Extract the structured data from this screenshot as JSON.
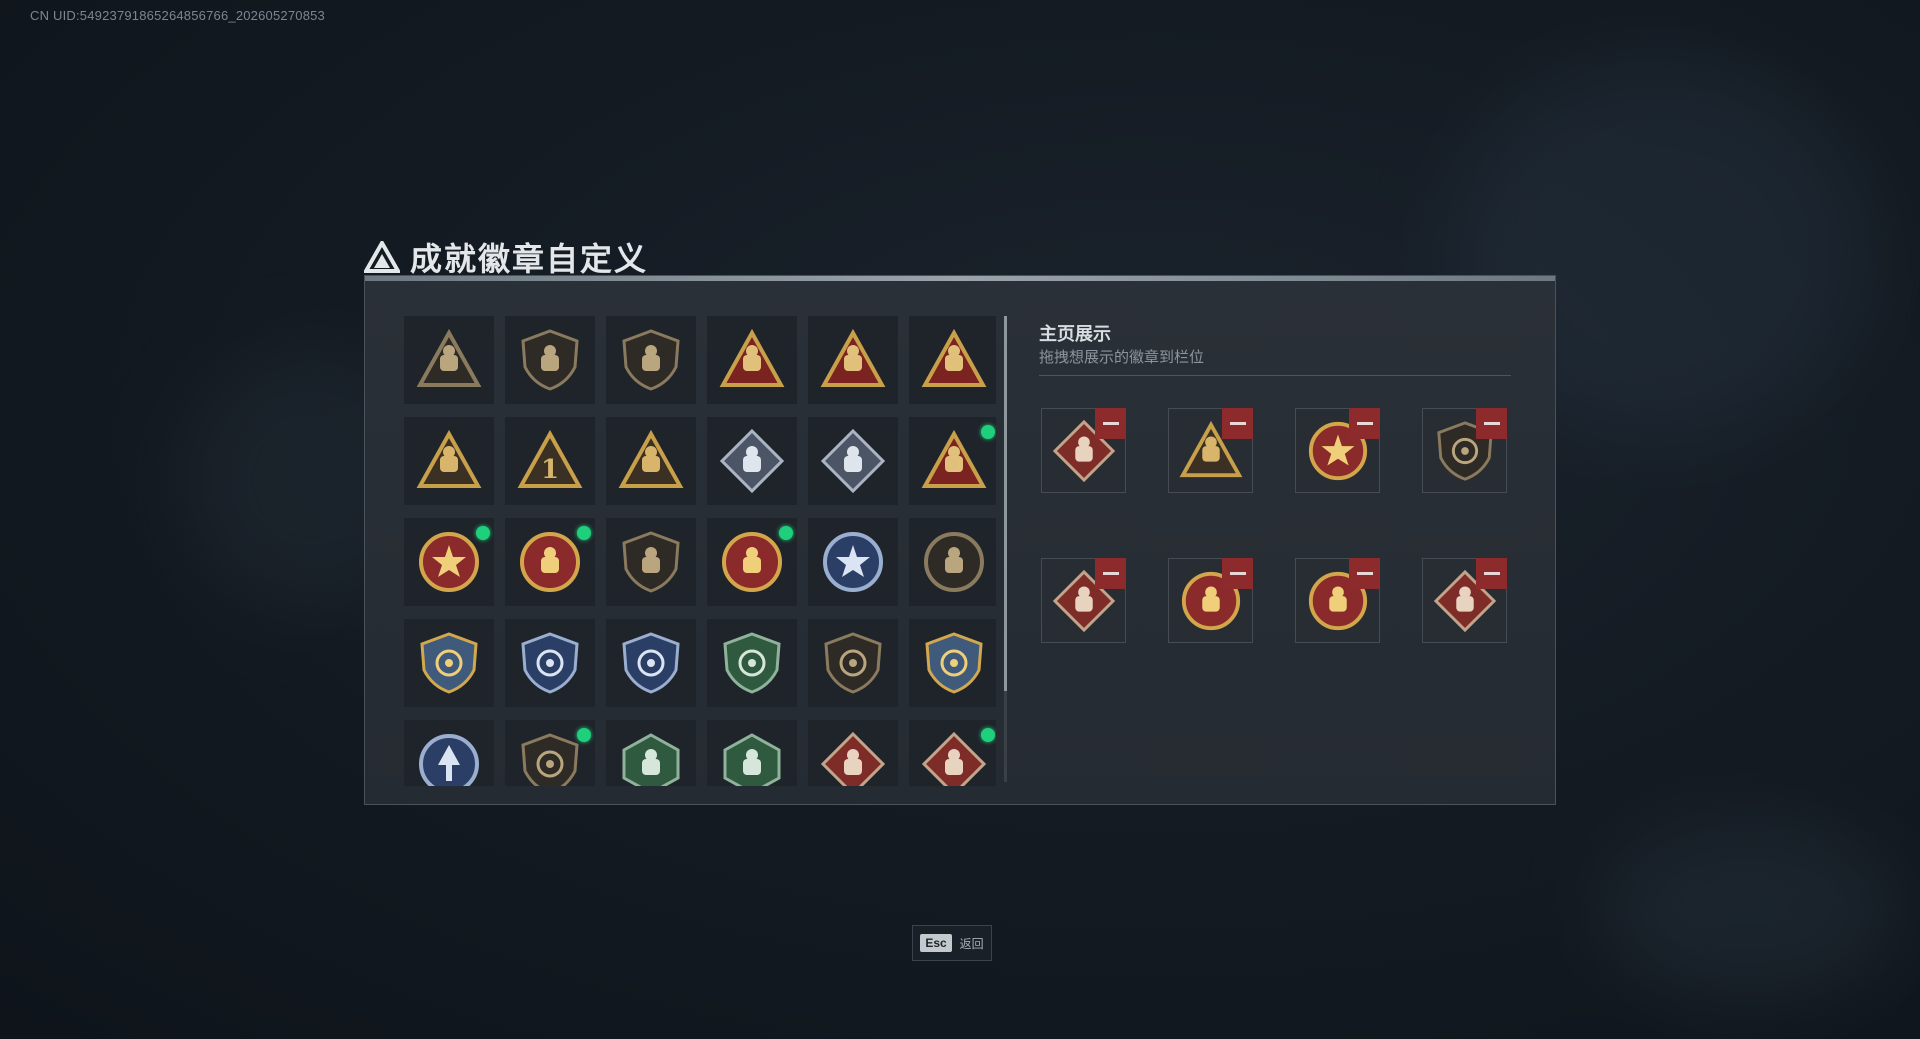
{
  "uid_text": "CN UID:549237918652648567​66_202605270853",
  "title": "成就徽章自定义",
  "showcase": {
    "title": "主页展示",
    "subtitle": "拖拽想展示的徽章到栏位"
  },
  "footer": {
    "esc_key": "Esc",
    "esc_label": "返回"
  },
  "badges": [
    {
      "icon": "dark-shield-triangle-icon",
      "style": "dark",
      "new": false
    },
    {
      "icon": "helicopter-shield-icon",
      "style": "dark",
      "new": false
    },
    {
      "icon": "jet-shield-icon",
      "style": "dark",
      "new": false
    },
    {
      "icon": "hand-sign-triangle-icon",
      "style": "gold-red",
      "new": false
    },
    {
      "icon": "rocket-launcher-triangle-icon",
      "style": "gold-red",
      "new": false
    },
    {
      "icon": "trophy-triangle-icon",
      "style": "gold-red",
      "new": false
    },
    {
      "icon": "tank-triangle-icon",
      "style": "gold-dark",
      "new": false
    },
    {
      "icon": "number-one-triangle-icon",
      "style": "gold-dark",
      "new": false
    },
    {
      "icon": "soldier-triangle-icon",
      "style": "gold-dark",
      "new": false
    },
    {
      "icon": "rose-diamond-icon",
      "style": "silver",
      "new": false
    },
    {
      "icon": "gun-diamond-icon",
      "style": "silver",
      "new": false
    },
    {
      "icon": "runner-triangle-icon",
      "style": "gold-red",
      "new": true
    },
    {
      "icon": "star-medal-icon",
      "style": "medal",
      "new": true
    },
    {
      "icon": "eagle-medal-icon",
      "style": "medal",
      "new": true
    },
    {
      "icon": "bronze-shield-icon",
      "style": "dark",
      "new": false
    },
    {
      "icon": "lion-medal-icon",
      "style": "medal",
      "new": true
    },
    {
      "icon": "starburst-medal-icon",
      "style": "blue",
      "new": false
    },
    {
      "icon": "helmet-medal-icon",
      "style": "dark",
      "new": false
    },
    {
      "icon": "crosshair-gold-shield-icon",
      "style": "gold",
      "new": false
    },
    {
      "icon": "crosshair-blue-shield-icon",
      "style": "blue",
      "new": false
    },
    {
      "icon": "crosshair-blue-shield-icon",
      "style": "blue",
      "new": false
    },
    {
      "icon": "crosshair-green-shield-icon",
      "style": "green",
      "new": false
    },
    {
      "icon": "crosshair-dark-shield-icon",
      "style": "dark",
      "new": false
    },
    {
      "icon": "crosshair-gold-shield-icon",
      "style": "gold",
      "new": false
    },
    {
      "icon": "arrow-emblem-icon",
      "style": "blue",
      "new": false
    },
    {
      "icon": "target-shield-icon",
      "style": "dark",
      "new": true
    },
    {
      "icon": "rifle-hexagon-icon",
      "style": "green",
      "new": false
    },
    {
      "icon": "soldier-hexagon-icon",
      "style": "green",
      "new": false
    },
    {
      "icon": "dragon-diamond-icon",
      "style": "red",
      "new": false
    },
    {
      "icon": "dragon-diamond-icon",
      "style": "red",
      "new": true
    }
  ],
  "slots": [
    {
      "icon": "plane-diamond-icon",
      "style": "red"
    },
    {
      "icon": "soldier-triangle-icon",
      "style": "gold-dark"
    },
    {
      "icon": "star-medal-icon",
      "style": "medal"
    },
    {
      "icon": "target-shield-icon",
      "style": "dark"
    },
    {
      "icon": "runner-diamond-icon",
      "style": "red"
    },
    {
      "icon": "eagle-medal-icon",
      "style": "medal"
    },
    {
      "icon": "lion-medal-icon",
      "style": "medal"
    },
    {
      "icon": "dragon-diamond-icon",
      "style": "red"
    }
  ],
  "colors": {
    "new_dot": "#1ed07b",
    "remove": "#8d2a2c",
    "gold": "#c9a04a",
    "red": "#8a2a2a"
  }
}
